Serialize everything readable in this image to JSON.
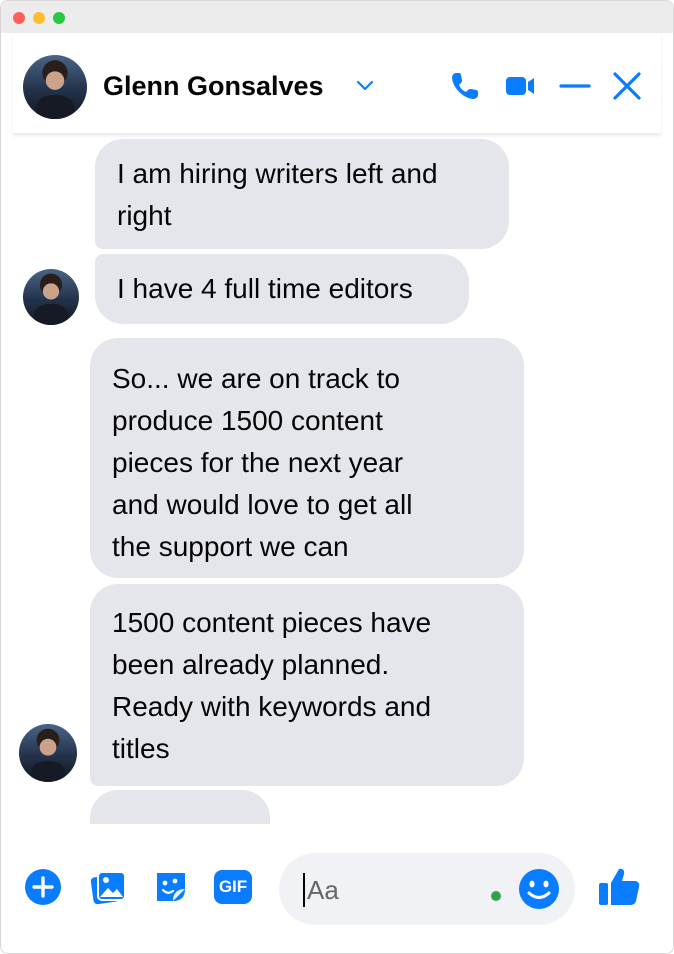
{
  "header": {
    "contact_name": "Glenn Gonsalves"
  },
  "messages": [
    {
      "text_lines": [
        "I am hiring writers left and",
        "right"
      ]
    },
    {
      "text_lines": [
        "I have 4 full time editors"
      ]
    },
    {
      "text_lines": [
        "So... we are on track to",
        "produce 1500 content",
        "pieces for the next year",
        "and would love to get all",
        "the support we can"
      ]
    },
    {
      "text_lines": [
        "1500 content pieces have",
        "been already planned.",
        "Ready with keywords and",
        "titles"
      ]
    }
  ],
  "composer": {
    "placeholder": "Aa",
    "gif_label": "GIF"
  },
  "colors": {
    "accent": "#0a7cff",
    "bubble": "#e4e6eb",
    "online": "#31a24c"
  },
  "icons": [
    "phone-icon",
    "video-icon",
    "minimize-icon",
    "close-icon",
    "plus-icon",
    "image-icon",
    "sticker-icon",
    "gif-icon",
    "emoji-icon",
    "like-icon"
  ]
}
